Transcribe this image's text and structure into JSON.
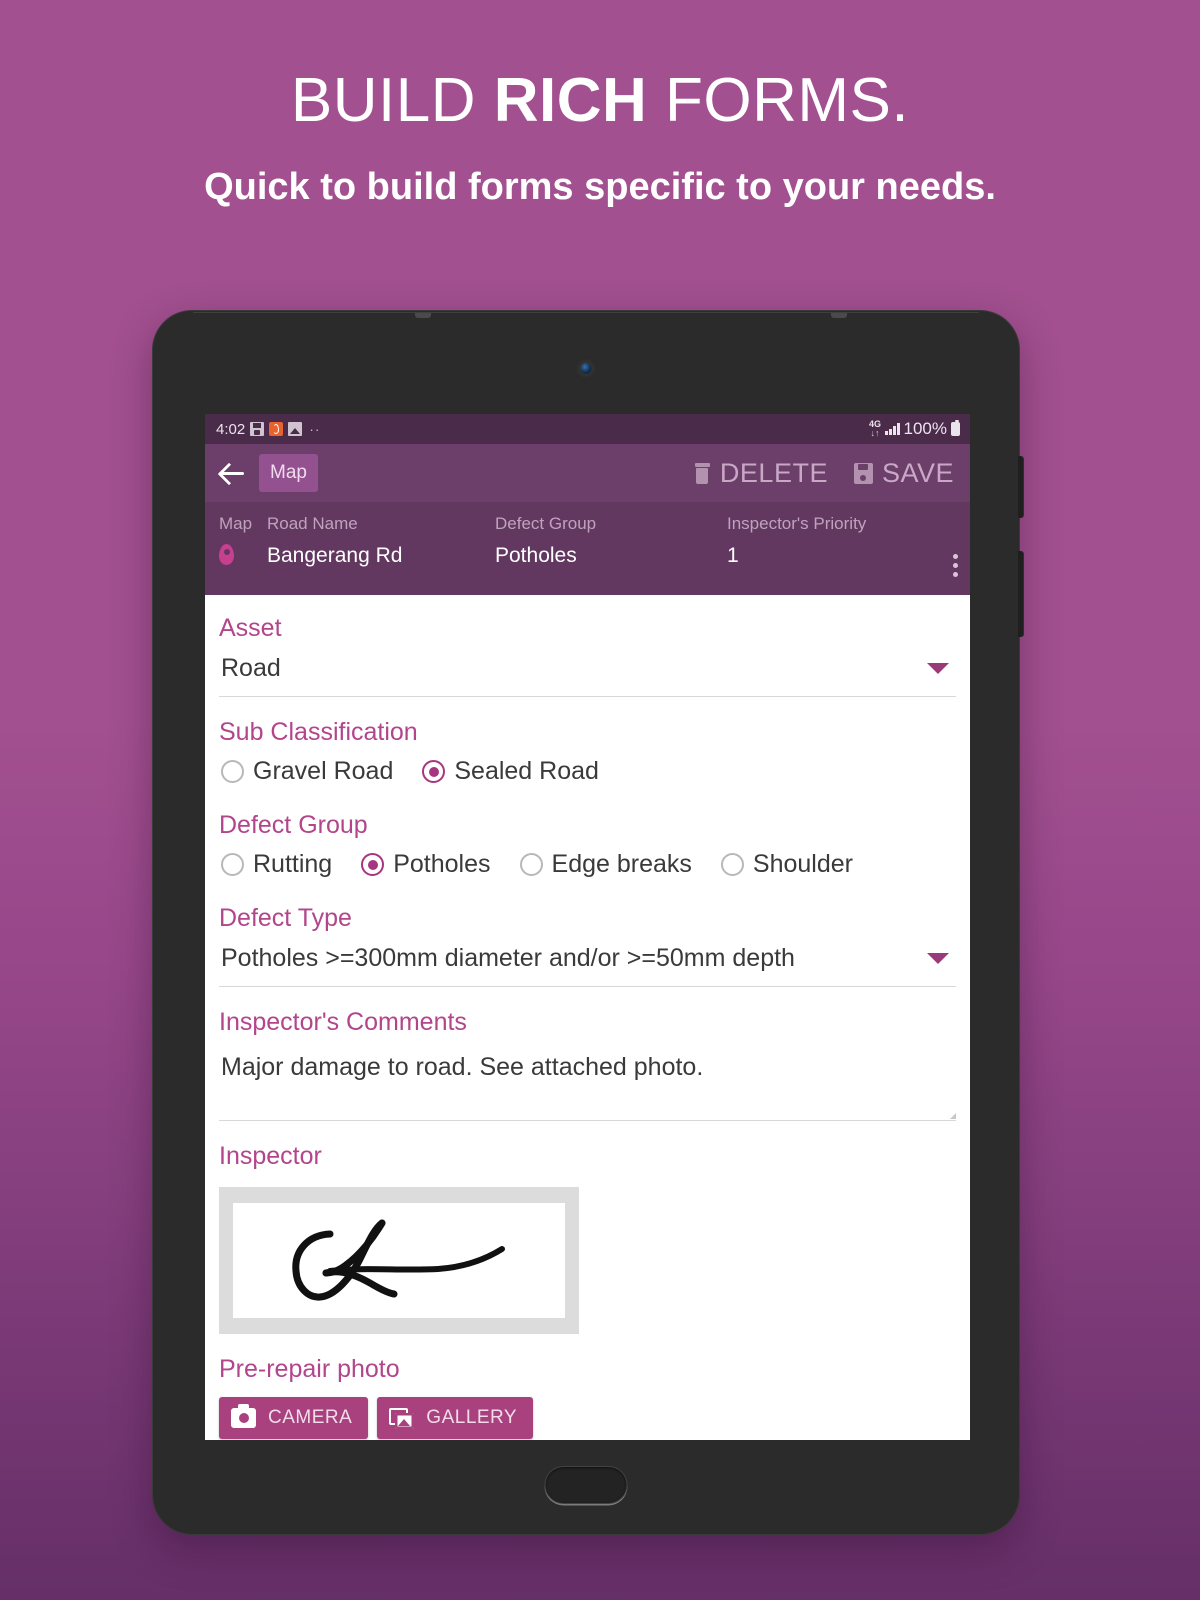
{
  "promo": {
    "title_pre": "BUILD ",
    "title_bold": "RICH",
    "title_post": " FORMS.",
    "subtitle": "Quick to build forms specific to your needs."
  },
  "device": {
    "front_camera": "front-camera",
    "home_button": "home-button"
  },
  "statusbar": {
    "time": "4:02",
    "icons": [
      "save-icon",
      "app-icon",
      "image-icon"
    ],
    "more_dots": "··",
    "network_line1": "4G",
    "network_line2": "↓↑",
    "battery_pct": "100%"
  },
  "appbar": {
    "back_icon": "back-arrow-icon",
    "chip_label": "Map",
    "delete_label": "DELETE",
    "save_label": "SAVE"
  },
  "summary": {
    "map_label": "Map",
    "road_label": "Road Name",
    "road_value": "Bangerang Rd",
    "group_label": "Defect Group",
    "group_value": "Potholes",
    "priority_label": "Inspector's Priority",
    "priority_value": "1"
  },
  "form": {
    "asset": {
      "label": "Asset",
      "value": "Road"
    },
    "sub_classification": {
      "label": "Sub Classification",
      "options": [
        {
          "label": "Gravel Road",
          "selected": false
        },
        {
          "label": "Sealed Road",
          "selected": true
        }
      ]
    },
    "defect_group": {
      "label": "Defect Group",
      "options": [
        {
          "label": "Rutting",
          "selected": false
        },
        {
          "label": "Potholes",
          "selected": true
        },
        {
          "label": "Edge breaks",
          "selected": false
        },
        {
          "label": "Shoulder",
          "selected": false
        }
      ]
    },
    "defect_type": {
      "label": "Defect Type",
      "value": "Potholes >=300mm diameter and/or >=50mm depth"
    },
    "comments": {
      "label": "Inspector's Comments",
      "value": "Major damage to road. See attached photo."
    },
    "inspector": {
      "label": "Inspector",
      "signature": "handwritten-signature"
    },
    "photo": {
      "label": "Pre-repair photo",
      "camera_label": "CAMERA",
      "gallery_label": "GALLERY"
    }
  },
  "colors": {
    "bg_top": "#a2508f",
    "bg_bottom": "#652f67",
    "appbar": "#6c3f6b",
    "summary_bar": "#623860",
    "statusbar": "#4a2b4a",
    "accent_label": "#b2458b",
    "accent_button": "#a9417f",
    "radio_selected": "#a7357f"
  }
}
